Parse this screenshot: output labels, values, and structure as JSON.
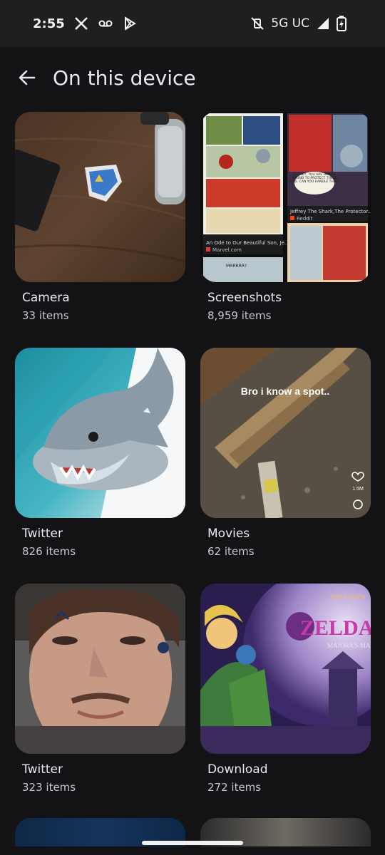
{
  "status_bar": {
    "time": "2:55",
    "network": "5G UC",
    "icons": [
      "x-icon",
      "voicemail-icon",
      "play-store-icon",
      "mute-vibrate-icon",
      "signal-icon",
      "battery-icon"
    ]
  },
  "header": {
    "title": "On this device",
    "back_icon": "arrow-back-icon"
  },
  "albums": [
    {
      "name": "Camera",
      "count": "33 items"
    },
    {
      "name": "Screenshots",
      "count": "8,959 items",
      "captions": [
        "JEFFREY, YOU ARE HONOR BOUND TO PROTECT THESE KIDS. CAN YOU HANDLE THAT?",
        "Jeffrey The Shark,The Protector...",
        "Reddit",
        "An Ode to Our Beautiful Son, Je...",
        "Marvel.com",
        "MRRRRR?"
      ]
    },
    {
      "name": "Twitter",
      "count": "826 items"
    },
    {
      "name": "Movies",
      "count": "62 items",
      "overlay": "Bro i know a spot..",
      "likes": "1.5M"
    },
    {
      "name": "Twitter",
      "count": "323 items"
    },
    {
      "name": "Download",
      "count": "272 items",
      "logo_text": "ZELDA",
      "subtitle": "MAJORA'S MA",
      "brand": "THE LEGEN"
    }
  ],
  "colors": {
    "background": "#131316",
    "status_bar": "#1f1f22",
    "text_primary": "#ece7ee",
    "text_secondary": "#c9c4cc"
  }
}
